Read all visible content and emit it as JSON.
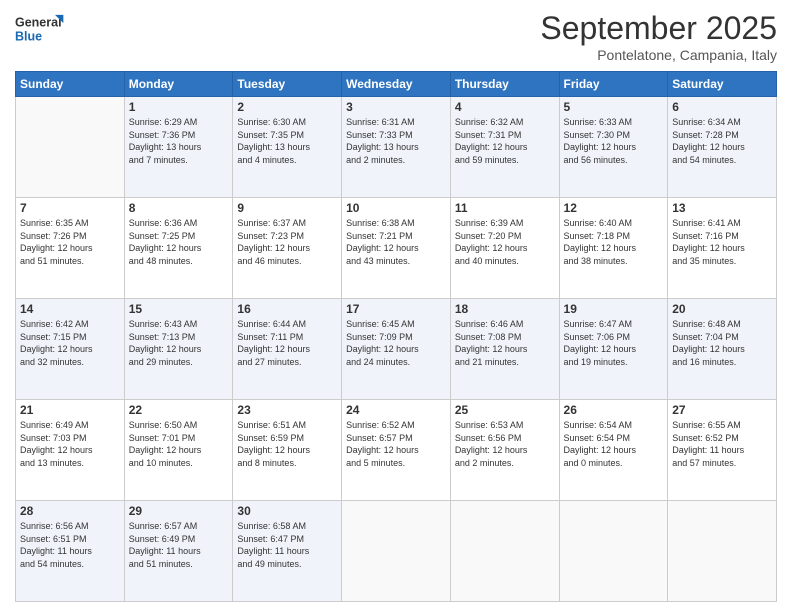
{
  "header": {
    "logo_line1": "General",
    "logo_line2": "Blue",
    "month_title": "September 2025",
    "subtitle": "Pontelatone, Campania, Italy"
  },
  "days_of_week": [
    "Sunday",
    "Monday",
    "Tuesday",
    "Wednesday",
    "Thursday",
    "Friday",
    "Saturday"
  ],
  "weeks": [
    [
      {
        "num": "",
        "info": ""
      },
      {
        "num": "1",
        "info": "Sunrise: 6:29 AM\nSunset: 7:36 PM\nDaylight: 13 hours\nand 7 minutes."
      },
      {
        "num": "2",
        "info": "Sunrise: 6:30 AM\nSunset: 7:35 PM\nDaylight: 13 hours\nand 4 minutes."
      },
      {
        "num": "3",
        "info": "Sunrise: 6:31 AM\nSunset: 7:33 PM\nDaylight: 13 hours\nand 2 minutes."
      },
      {
        "num": "4",
        "info": "Sunrise: 6:32 AM\nSunset: 7:31 PM\nDaylight: 12 hours\nand 59 minutes."
      },
      {
        "num": "5",
        "info": "Sunrise: 6:33 AM\nSunset: 7:30 PM\nDaylight: 12 hours\nand 56 minutes."
      },
      {
        "num": "6",
        "info": "Sunrise: 6:34 AM\nSunset: 7:28 PM\nDaylight: 12 hours\nand 54 minutes."
      }
    ],
    [
      {
        "num": "7",
        "info": "Sunrise: 6:35 AM\nSunset: 7:26 PM\nDaylight: 12 hours\nand 51 minutes."
      },
      {
        "num": "8",
        "info": "Sunrise: 6:36 AM\nSunset: 7:25 PM\nDaylight: 12 hours\nand 48 minutes."
      },
      {
        "num": "9",
        "info": "Sunrise: 6:37 AM\nSunset: 7:23 PM\nDaylight: 12 hours\nand 46 minutes."
      },
      {
        "num": "10",
        "info": "Sunrise: 6:38 AM\nSunset: 7:21 PM\nDaylight: 12 hours\nand 43 minutes."
      },
      {
        "num": "11",
        "info": "Sunrise: 6:39 AM\nSunset: 7:20 PM\nDaylight: 12 hours\nand 40 minutes."
      },
      {
        "num": "12",
        "info": "Sunrise: 6:40 AM\nSunset: 7:18 PM\nDaylight: 12 hours\nand 38 minutes."
      },
      {
        "num": "13",
        "info": "Sunrise: 6:41 AM\nSunset: 7:16 PM\nDaylight: 12 hours\nand 35 minutes."
      }
    ],
    [
      {
        "num": "14",
        "info": "Sunrise: 6:42 AM\nSunset: 7:15 PM\nDaylight: 12 hours\nand 32 minutes."
      },
      {
        "num": "15",
        "info": "Sunrise: 6:43 AM\nSunset: 7:13 PM\nDaylight: 12 hours\nand 29 minutes."
      },
      {
        "num": "16",
        "info": "Sunrise: 6:44 AM\nSunset: 7:11 PM\nDaylight: 12 hours\nand 27 minutes."
      },
      {
        "num": "17",
        "info": "Sunrise: 6:45 AM\nSunset: 7:09 PM\nDaylight: 12 hours\nand 24 minutes."
      },
      {
        "num": "18",
        "info": "Sunrise: 6:46 AM\nSunset: 7:08 PM\nDaylight: 12 hours\nand 21 minutes."
      },
      {
        "num": "19",
        "info": "Sunrise: 6:47 AM\nSunset: 7:06 PM\nDaylight: 12 hours\nand 19 minutes."
      },
      {
        "num": "20",
        "info": "Sunrise: 6:48 AM\nSunset: 7:04 PM\nDaylight: 12 hours\nand 16 minutes."
      }
    ],
    [
      {
        "num": "21",
        "info": "Sunrise: 6:49 AM\nSunset: 7:03 PM\nDaylight: 12 hours\nand 13 minutes."
      },
      {
        "num": "22",
        "info": "Sunrise: 6:50 AM\nSunset: 7:01 PM\nDaylight: 12 hours\nand 10 minutes."
      },
      {
        "num": "23",
        "info": "Sunrise: 6:51 AM\nSunset: 6:59 PM\nDaylight: 12 hours\nand 8 minutes."
      },
      {
        "num": "24",
        "info": "Sunrise: 6:52 AM\nSunset: 6:57 PM\nDaylight: 12 hours\nand 5 minutes."
      },
      {
        "num": "25",
        "info": "Sunrise: 6:53 AM\nSunset: 6:56 PM\nDaylight: 12 hours\nand 2 minutes."
      },
      {
        "num": "26",
        "info": "Sunrise: 6:54 AM\nSunset: 6:54 PM\nDaylight: 12 hours\nand 0 minutes."
      },
      {
        "num": "27",
        "info": "Sunrise: 6:55 AM\nSunset: 6:52 PM\nDaylight: 11 hours\nand 57 minutes."
      }
    ],
    [
      {
        "num": "28",
        "info": "Sunrise: 6:56 AM\nSunset: 6:51 PM\nDaylight: 11 hours\nand 54 minutes."
      },
      {
        "num": "29",
        "info": "Sunrise: 6:57 AM\nSunset: 6:49 PM\nDaylight: 11 hours\nand 51 minutes."
      },
      {
        "num": "30",
        "info": "Sunrise: 6:58 AM\nSunset: 6:47 PM\nDaylight: 11 hours\nand 49 minutes."
      },
      {
        "num": "",
        "info": ""
      },
      {
        "num": "",
        "info": ""
      },
      {
        "num": "",
        "info": ""
      },
      {
        "num": "",
        "info": ""
      }
    ]
  ]
}
